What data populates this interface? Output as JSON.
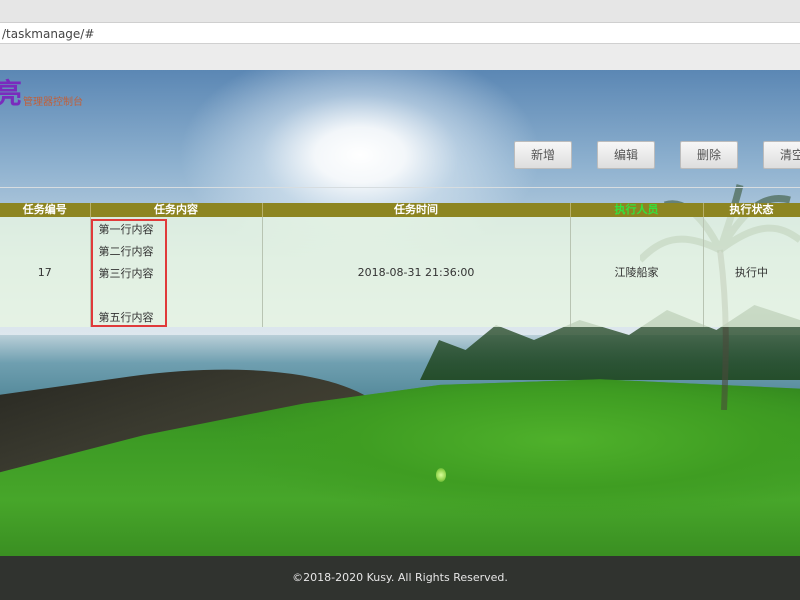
{
  "browser": {
    "url": "/taskmanage/#"
  },
  "brand": {
    "logo_char": "亮",
    "subtitle": "管理器控制台"
  },
  "toolbar": {
    "add": "新增",
    "edit": "编辑",
    "delete": "删除",
    "clear": "清空"
  },
  "table": {
    "headers": [
      "任务编号",
      "任务内容",
      "任务时间",
      "执行人员",
      "执行状态"
    ],
    "rows": [
      {
        "id": "17",
        "content_lines": [
          "第一行内容",
          "第二行内容",
          "第三行内容",
          "",
          "第五行内容"
        ],
        "time": "2018-08-31 21:36:00",
        "person": "江陵船家",
        "status": "执行中"
      }
    ]
  },
  "footer": {
    "text": "©2018-2020 Kusy. All Rights Reserved."
  },
  "colors": {
    "header_bg": "#8d8521",
    "highlight_border": "#e03a3a",
    "header_green": "#34e13d"
  }
}
